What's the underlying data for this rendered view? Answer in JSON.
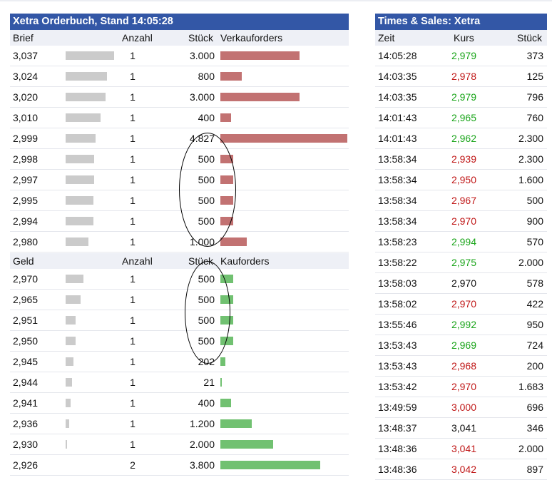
{
  "orderbook": {
    "title": "Xetra Orderbuch, Stand 14:05:28",
    "ask_header": {
      "price": "Brief",
      "count": "Anzahl",
      "qty": "Stück",
      "orders": "Verkauforders"
    },
    "bid_header": {
      "price": "Geld",
      "count": "Anzahl",
      "qty": "Stück",
      "orders": "Kauforders"
    },
    "asks": [
      {
        "price": "3,037",
        "count": "1",
        "qty": "3.000",
        "depth": 0.39,
        "volume": 3000
      },
      {
        "price": "3,024",
        "count": "1",
        "qty": "800",
        "depth": 0.33,
        "volume": 800
      },
      {
        "price": "3,020",
        "count": "1",
        "qty": "3.000",
        "depth": 0.32,
        "volume": 3000
      },
      {
        "price": "3,010",
        "count": "1",
        "qty": "400",
        "depth": 0.28,
        "volume": 400
      },
      {
        "price": "2,999",
        "count": "1",
        "qty": "4.827",
        "depth": 0.24,
        "volume": 4827
      },
      {
        "price": "2,998",
        "count": "1",
        "qty": "500",
        "depth": 0.23,
        "volume": 500
      },
      {
        "price": "2,997",
        "count": "1",
        "qty": "500",
        "depth": 0.23,
        "volume": 500
      },
      {
        "price": "2,995",
        "count": "1",
        "qty": "500",
        "depth": 0.22,
        "volume": 500
      },
      {
        "price": "2,994",
        "count": "1",
        "qty": "500",
        "depth": 0.22,
        "volume": 500
      },
      {
        "price": "2,980",
        "count": "1",
        "qty": "1.000",
        "depth": 0.18,
        "volume": 1000
      }
    ],
    "bids": [
      {
        "price": "2,970",
        "count": "1",
        "qty": "500",
        "depth": 0.14,
        "volume": 500
      },
      {
        "price": "2,965",
        "count": "1",
        "qty": "500",
        "depth": 0.12,
        "volume": 500
      },
      {
        "price": "2,951",
        "count": "1",
        "qty": "500",
        "depth": 0.08,
        "volume": 500
      },
      {
        "price": "2,950",
        "count": "1",
        "qty": "500",
        "depth": 0.08,
        "volume": 500
      },
      {
        "price": "2,945",
        "count": "1",
        "qty": "202",
        "depth": 0.06,
        "volume": 202
      },
      {
        "price": "2,944",
        "count": "1",
        "qty": "21",
        "depth": 0.05,
        "volume": 21
      },
      {
        "price": "2,941",
        "count": "1",
        "qty": "400",
        "depth": 0.04,
        "volume": 400
      },
      {
        "price": "2,936",
        "count": "1",
        "qty": "1.200",
        "depth": 0.03,
        "volume": 1200
      },
      {
        "price": "2,930",
        "count": "1",
        "qty": "2.000",
        "depth": 0.01,
        "volume": 2000
      },
      {
        "price": "2,926",
        "count": "2",
        "qty": "3.800",
        "depth": 0,
        "volume": 3800
      }
    ],
    "max_volume": 4827
  },
  "times_sales": {
    "title": "Times & Sales: Xetra",
    "header": {
      "time": "Zeit",
      "price": "Kurs",
      "qty": "Stück"
    },
    "trades": [
      {
        "time": "14:05:28",
        "price": "2,979",
        "qty": "373",
        "dir": "up"
      },
      {
        "time": "14:03:35",
        "price": "2,978",
        "qty": "125",
        "dir": "down"
      },
      {
        "time": "14:03:35",
        "price": "2,979",
        "qty": "796",
        "dir": "up"
      },
      {
        "time": "14:01:43",
        "price": "2,965",
        "qty": "760",
        "dir": "up"
      },
      {
        "time": "14:01:43",
        "price": "2,962",
        "qty": "2.300",
        "dir": "up"
      },
      {
        "time": "13:58:34",
        "price": "2,939",
        "qty": "2.300",
        "dir": "down"
      },
      {
        "time": "13:58:34",
        "price": "2,950",
        "qty": "1.600",
        "dir": "down"
      },
      {
        "time": "13:58:34",
        "price": "2,967",
        "qty": "500",
        "dir": "down"
      },
      {
        "time": "13:58:34",
        "price": "2,970",
        "qty": "900",
        "dir": "down"
      },
      {
        "time": "13:58:23",
        "price": "2,994",
        "qty": "570",
        "dir": "up"
      },
      {
        "time": "13:58:22",
        "price": "2,975",
        "qty": "2.000",
        "dir": "up"
      },
      {
        "time": "13:58:03",
        "price": "2,970",
        "qty": "578",
        "dir": "neutral"
      },
      {
        "time": "13:58:02",
        "price": "2,970",
        "qty": "422",
        "dir": "down"
      },
      {
        "time": "13:55:46",
        "price": "2,992",
        "qty": "950",
        "dir": "up"
      },
      {
        "time": "13:53:43",
        "price": "2,969",
        "qty": "724",
        "dir": "up"
      },
      {
        "time": "13:53:43",
        "price": "2,968",
        "qty": "200",
        "dir": "down"
      },
      {
        "time": "13:53:42",
        "price": "2,970",
        "qty": "1.683",
        "dir": "down"
      },
      {
        "time": "13:49:59",
        "price": "3,000",
        "qty": "696",
        "dir": "down"
      },
      {
        "time": "13:48:37",
        "price": "3,041",
        "qty": "346",
        "dir": "neutral"
      },
      {
        "time": "13:48:36",
        "price": "3,041",
        "qty": "2.000",
        "dir": "down"
      },
      {
        "time": "13:48:36",
        "price": "3,042",
        "qty": "897",
        "dir": "down"
      }
    ]
  },
  "colors": {
    "header_bg": "#3357a6",
    "ask_bar": "#c27272",
    "bid_bar": "#71c171",
    "depth_bar": "#cbcbcb",
    "up": "#1aa51a",
    "down": "#c01818"
  }
}
